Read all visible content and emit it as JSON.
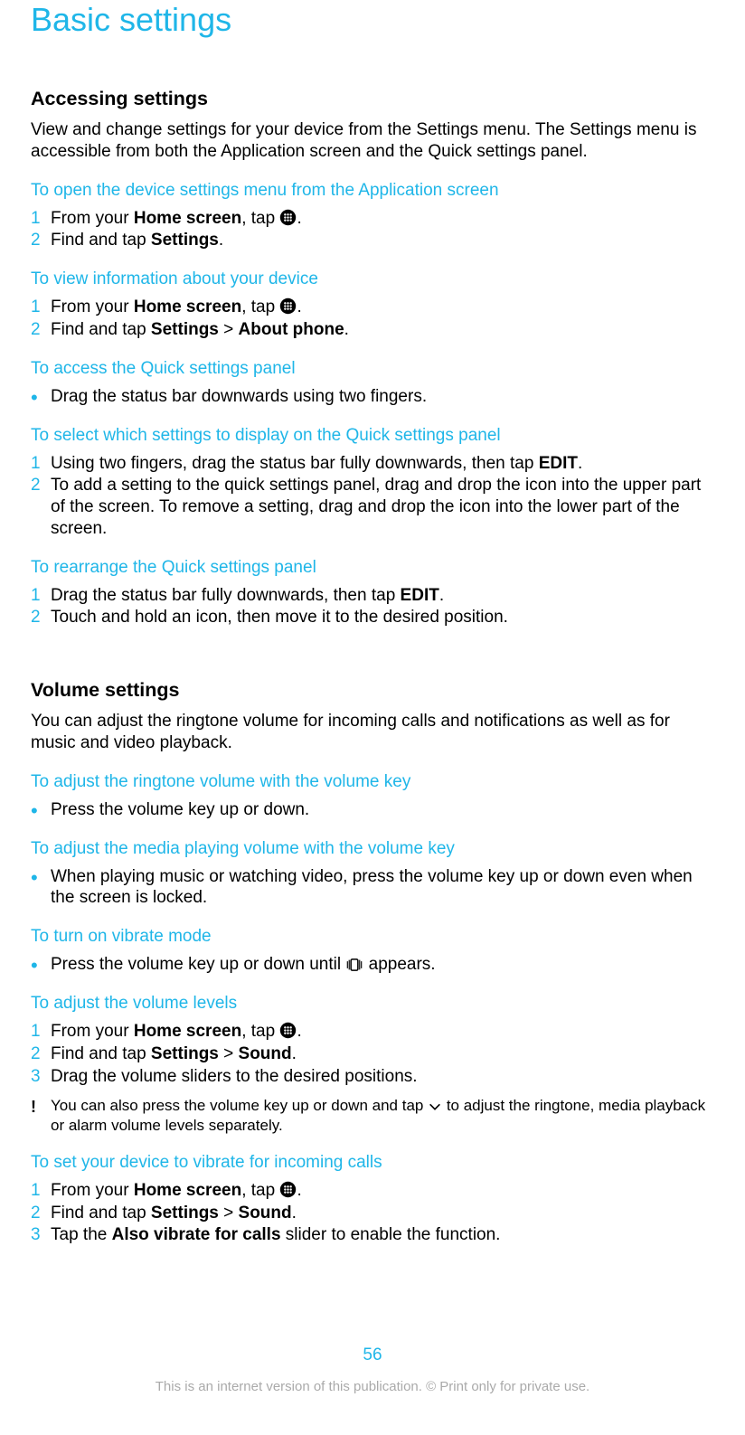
{
  "page_title": "Basic settings",
  "section1": {
    "title": "Accessing settings",
    "body": "View and change settings for your device from the Settings menu. The Settings menu is accessible from both the Application screen and the Quick settings panel.",
    "task1_heading": "To open the device settings menu from the Application screen",
    "task1_step1_a": "From your ",
    "task1_step1_b": "Home screen",
    "task1_step1_c": ", tap ",
    "task1_step1_d": ".",
    "task1_step2_a": "Find and tap ",
    "task1_step2_b": "Settings",
    "task1_step2_c": ".",
    "task2_heading": "To view information about your device",
    "task2_step1_a": "From your ",
    "task2_step1_b": "Home screen",
    "task2_step1_c": ", tap ",
    "task2_step1_d": ".",
    "task2_step2_a": "Find and tap ",
    "task2_step2_b": "Settings",
    "task2_step2_c": " > ",
    "task2_step2_d": "About phone",
    "task2_step2_e": ".",
    "task3_heading": "To access the Quick settings panel",
    "task3_bullet": "Drag the status bar downwards using two fingers.",
    "task4_heading": "To select which settings to display on the Quick settings panel",
    "task4_step1_a": "Using two fingers, drag the status bar fully downwards, then tap ",
    "task4_step1_b": "EDIT",
    "task4_step1_c": ".",
    "task4_step2": "To add a setting to the quick settings panel, drag and drop the icon into the upper part of the screen. To remove a setting, drag and drop the icon into the lower part of the screen.",
    "task5_heading": "To rearrange the Quick settings panel",
    "task5_step1_a": "Drag the status bar fully downwards, then tap ",
    "task5_step1_b": "EDIT",
    "task5_step1_c": ".",
    "task5_step2": "Touch and hold an icon, then move it to the desired position."
  },
  "section2": {
    "title": "Volume settings",
    "body": "You can adjust the ringtone volume for incoming calls and notifications as well as for music and video playback.",
    "task1_heading": "To adjust the ringtone volume with the volume key",
    "task1_bullet": "Press the volume key up or down.",
    "task2_heading": "To adjust the media playing volume with the volume key",
    "task2_bullet": "When playing music or watching video, press the volume key up or down even when the screen is locked.",
    "task3_heading": "To turn on vibrate mode",
    "task3_bullet_a": "Press the volume key up or down until ",
    "task3_bullet_b": " appears.",
    "task4_heading": "To adjust the volume levels",
    "task4_step1_a": "From your ",
    "task4_step1_b": "Home screen",
    "task4_step1_c": ", tap ",
    "task4_step1_d": ".",
    "task4_step2_a": "Find and tap ",
    "task4_step2_b": "Settings",
    "task4_step2_c": " > ",
    "task4_step2_d": "Sound",
    "task4_step2_e": ".",
    "task4_step3": "Drag the volume sliders to the desired positions.",
    "task4_note_a": "You can also press the volume key up or down and tap ",
    "task4_note_b": " to adjust the ringtone, media playback or alarm volume levels separately.",
    "task5_heading": "To set your device to vibrate for incoming calls",
    "task5_step1_a": "From your ",
    "task5_step1_b": "Home screen",
    "task5_step1_c": ", tap ",
    "task5_step1_d": ".",
    "task5_step2_a": "Find and tap ",
    "task5_step2_b": "Settings",
    "task5_step2_c": " > ",
    "task5_step2_d": "Sound",
    "task5_step2_e": ".",
    "task5_step3_a": "Tap the ",
    "task5_step3_b": "Also vibrate for calls",
    "task5_step3_c": " slider to enable the function."
  },
  "page_number": "56",
  "footer": "This is an internet version of this publication. © Print only for private use."
}
